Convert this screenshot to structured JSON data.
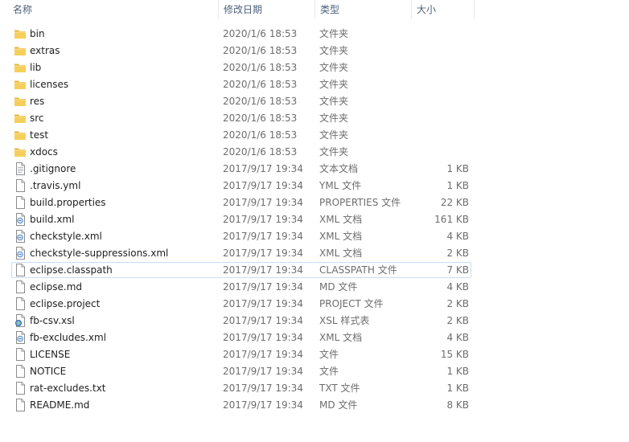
{
  "header": {
    "name": "名称",
    "date": "修改日期",
    "type": "类型",
    "size": "大小"
  },
  "files": [
    {
      "name": "bin",
      "date": "2020/1/6 18:53",
      "type": "文件夹",
      "size": "",
      "icon": "folder-icon"
    },
    {
      "name": "extras",
      "date": "2020/1/6 18:53",
      "type": "文件夹",
      "size": "",
      "icon": "folder-icon"
    },
    {
      "name": "lib",
      "date": "2020/1/6 18:53",
      "type": "文件夹",
      "size": "",
      "icon": "folder-icon"
    },
    {
      "name": "licenses",
      "date": "2020/1/6 18:53",
      "type": "文件夹",
      "size": "",
      "icon": "folder-icon"
    },
    {
      "name": "res",
      "date": "2020/1/6 18:53",
      "type": "文件夹",
      "size": "",
      "icon": "folder-icon"
    },
    {
      "name": "src",
      "date": "2020/1/6 18:53",
      "type": "文件夹",
      "size": "",
      "icon": "folder-icon"
    },
    {
      "name": "test",
      "date": "2020/1/6 18:53",
      "type": "文件夹",
      "size": "",
      "icon": "folder-icon"
    },
    {
      "name": "xdocs",
      "date": "2020/1/6 18:53",
      "type": "文件夹",
      "size": "",
      "icon": "folder-icon"
    },
    {
      "name": ".gitignore",
      "date": "2017/9/17 19:34",
      "type": "文本文档",
      "size": "1 KB",
      "icon": "text-file-icon"
    },
    {
      "name": ".travis.yml",
      "date": "2017/9/17 19:34",
      "type": "YML 文件",
      "size": "1 KB",
      "icon": "file-icon"
    },
    {
      "name": "build.properties",
      "date": "2017/9/17 19:34",
      "type": "PROPERTIES 文件",
      "size": "22 KB",
      "icon": "file-icon"
    },
    {
      "name": "build.xml",
      "date": "2017/9/17 19:34",
      "type": "XML 文档",
      "size": "161 KB",
      "icon": "xml-file-icon"
    },
    {
      "name": "checkstyle.xml",
      "date": "2017/9/17 19:34",
      "type": "XML 文档",
      "size": "4 KB",
      "icon": "xml-file-icon"
    },
    {
      "name": "checkstyle-suppressions.xml",
      "date": "2017/9/17 19:34",
      "type": "XML 文档",
      "size": "2 KB",
      "icon": "xml-file-icon"
    },
    {
      "name": "eclipse.classpath",
      "date": "2017/9/17 19:34",
      "type": "CLASSPATH 文件",
      "size": "7 KB",
      "icon": "file-icon"
    },
    {
      "name": "eclipse.md",
      "date": "2017/9/17 19:34",
      "type": "MD 文件",
      "size": "4 KB",
      "icon": "file-icon"
    },
    {
      "name": "eclipse.project",
      "date": "2017/9/17 19:34",
      "type": "PROJECT 文件",
      "size": "2 KB",
      "icon": "file-icon"
    },
    {
      "name": "fb-csv.xsl",
      "date": "2017/9/17 19:34",
      "type": "XSL 样式表",
      "size": "2 KB",
      "icon": "xsl-file-icon"
    },
    {
      "name": "fb-excludes.xml",
      "date": "2017/9/17 19:34",
      "type": "XML 文档",
      "size": "4 KB",
      "icon": "xml-file-icon"
    },
    {
      "name": "LICENSE",
      "date": "2017/9/17 19:34",
      "type": "文件",
      "size": "15 KB",
      "icon": "file-icon"
    },
    {
      "name": "NOTICE",
      "date": "2017/9/17 19:34",
      "type": "文件",
      "size": "1 KB",
      "icon": "file-icon"
    },
    {
      "name": "rat-excludes.txt",
      "date": "2017/9/17 19:34",
      "type": "TXT 文件",
      "size": "1 KB",
      "icon": "file-icon"
    },
    {
      "name": "README.md",
      "date": "2017/9/17 19:34",
      "type": "MD 文件",
      "size": "8 KB",
      "icon": "file-icon"
    }
  ],
  "focused_file": "eclipse.classpath"
}
